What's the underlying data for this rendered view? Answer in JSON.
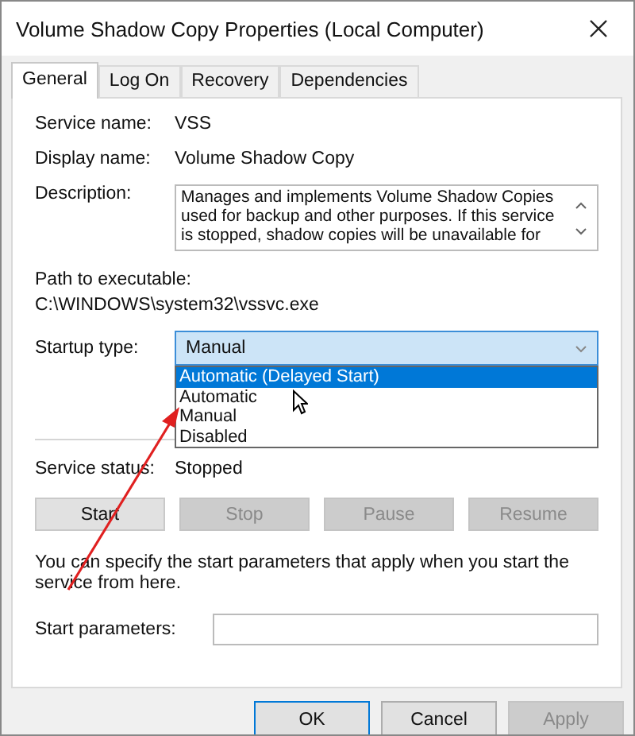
{
  "window": {
    "title": "Volume Shadow Copy Properties (Local Computer)"
  },
  "tabs": [
    {
      "label": "General",
      "selected": true
    },
    {
      "label": "Log On",
      "selected": false
    },
    {
      "label": "Recovery",
      "selected": false
    },
    {
      "label": "Dependencies",
      "selected": false
    }
  ],
  "info": [
    {
      "label": "Service name:",
      "value": "VSS"
    },
    {
      "label": "Display name:",
      "value": "Volume Shadow Copy"
    }
  ],
  "description": {
    "label": "Description:",
    "text": "Manages and implements Volume Shadow Copies used for backup and other purposes. If this service is stopped, shadow copies will be unavailable for"
  },
  "path": {
    "label": "Path to executable:",
    "value": "C:\\WINDOWS\\system32\\vssvc.exe"
  },
  "startup_type": {
    "label": "Startup type:",
    "value": "Manual",
    "expanded": true,
    "options": [
      {
        "label": "Automatic (Delayed Start)",
        "highlighted": true
      },
      {
        "label": "Automatic",
        "highlighted": false
      },
      {
        "label": "Manual",
        "highlighted": false
      },
      {
        "label": "Disabled",
        "highlighted": false
      }
    ]
  },
  "service_status": {
    "label": "Service status:",
    "value": "Stopped"
  },
  "service_buttons": [
    {
      "label": "Start",
      "disabled": false
    },
    {
      "label": "Stop",
      "disabled": true
    },
    {
      "label": "Pause",
      "disabled": true
    },
    {
      "label": "Resume",
      "disabled": true
    }
  ],
  "note": "You can specify the start parameters that apply when you start the service from here.",
  "start_parameters": {
    "label": "Start parameters:"
  },
  "dialog_buttons": [
    {
      "label": "OK",
      "disabled": false,
      "default": true
    },
    {
      "label": "Cancel",
      "disabled": false,
      "default": false
    },
    {
      "label": "Apply",
      "disabled": true,
      "default": false
    }
  ]
}
